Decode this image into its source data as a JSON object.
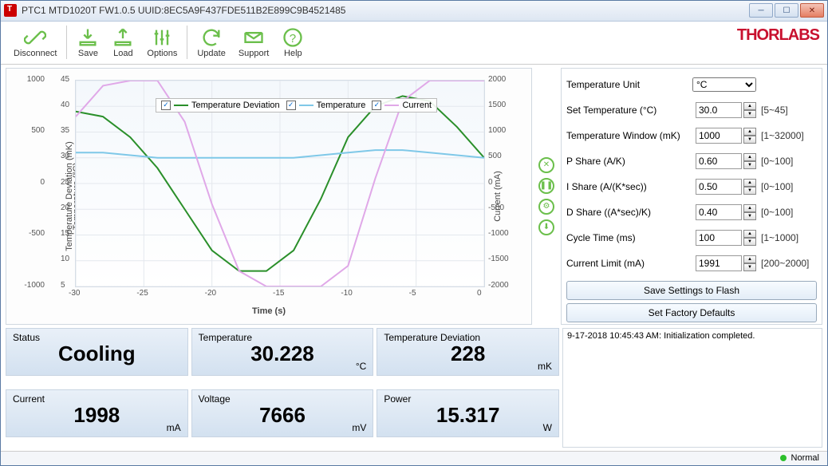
{
  "window": {
    "title": "PTC1 MTD1020T FW1.0.5 UUID:8EC5A9F437FDE511B2E899C9B4521485"
  },
  "logo": "THORLABS",
  "toolbar": {
    "disconnect": "Disconnect",
    "save": "Save",
    "load": "Load",
    "options": "Options",
    "update": "Update",
    "support": "Support",
    "help": "Help"
  },
  "chart": {
    "xlabel": "Time (s)",
    "ylabel_left1": "Temperature Deviation (mK)",
    "ylabel_left2": "Temperature (°C)",
    "ylabel_right": "Current (mA)",
    "legend": {
      "a": "Temperature Deviation",
      "b": "Temperature",
      "c": "Current"
    }
  },
  "chart_data": {
    "type": "line",
    "x": [
      -30,
      -28,
      -26,
      -24,
      -22,
      -20,
      -18,
      -16,
      -14,
      -12,
      -10,
      -8,
      -6,
      -4,
      -2,
      0
    ],
    "xlim": [
      -30,
      0
    ],
    "y_left1_lim": [
      -1000,
      1000
    ],
    "y_left1_ticks": [
      -1000,
      -500,
      0,
      500,
      1000
    ],
    "y_left2_lim": [
      5,
      45
    ],
    "y_left2_ticks": [
      5,
      10,
      15,
      20,
      25,
      30,
      35,
      40,
      45
    ],
    "y_right_lim": [
      -2000,
      2000
    ],
    "y_right_ticks": [
      -2000,
      -1500,
      -1000,
      -500,
      0,
      500,
      1000,
      1500,
      2000
    ],
    "x_ticks": [
      -30,
      -25,
      -20,
      -15,
      -10,
      -5,
      0
    ],
    "series": [
      {
        "name": "Temperature Deviation",
        "axis": "left2",
        "color": "#2a8f2a",
        "y": [
          39,
          38,
          34,
          28,
          20,
          12,
          8,
          8,
          12,
          22,
          34,
          40,
          42,
          41,
          36,
          30
        ]
      },
      {
        "name": "Temperature",
        "axis": "left2",
        "color": "#7fc8e8",
        "y": [
          31,
          31,
          30.5,
          30,
          30,
          30,
          30,
          30,
          30,
          30.5,
          31,
          31.5,
          31.5,
          31,
          30.5,
          30
        ]
      },
      {
        "name": "Current",
        "axis": "right",
        "color": "#e0a8e8",
        "y": [
          1300,
          1900,
          2000,
          2000,
          1200,
          -400,
          -1700,
          -2000,
          -2000,
          -2000,
          -1600,
          100,
          1600,
          2000,
          2000,
          2000
        ]
      }
    ]
  },
  "settings": {
    "rows": [
      {
        "label": "Temperature Unit",
        "type": "select",
        "value": "°C",
        "range": ""
      },
      {
        "label": "Set Temperature (°C)",
        "type": "number",
        "value": "30.0",
        "range": "[5~45]"
      },
      {
        "label": "Temperature Window (mK)",
        "type": "number",
        "value": "1000",
        "range": "[1~32000]"
      },
      {
        "label": "P Share (A/K)",
        "type": "number",
        "value": "0.60",
        "range": "[0~100]"
      },
      {
        "label": "I Share (A/(K*sec))",
        "type": "number",
        "value": "0.50",
        "range": "[0~100]"
      },
      {
        "label": "D Share ((A*sec)/K)",
        "type": "number",
        "value": "0.40",
        "range": "[0~100]"
      },
      {
        "label": "Cycle Time (ms)",
        "type": "number",
        "value": "100",
        "range": "[1~1000]"
      },
      {
        "label": "Current Limit (mA)",
        "type": "number",
        "value": "1991",
        "range": "[200~2000]"
      }
    ],
    "save_btn": "Save Settings to Flash",
    "defaults_btn": "Set Factory Defaults"
  },
  "log": {
    "entry": "9-17-2018 10:45:43 AM: Initialization completed."
  },
  "stats": [
    {
      "label": "Status",
      "value": "Cooling",
      "unit": ""
    },
    {
      "label": "Temperature",
      "value": "30.228",
      "unit": "°C"
    },
    {
      "label": "Temperature Deviation",
      "value": "228",
      "unit": "mK"
    },
    {
      "label": "Current",
      "value": "1998",
      "unit": "mA"
    },
    {
      "label": "Voltage",
      "value": "7666",
      "unit": "mV"
    },
    {
      "label": "Power",
      "value": "15.317",
      "unit": "W"
    }
  ],
  "status": {
    "text": "Normal"
  }
}
